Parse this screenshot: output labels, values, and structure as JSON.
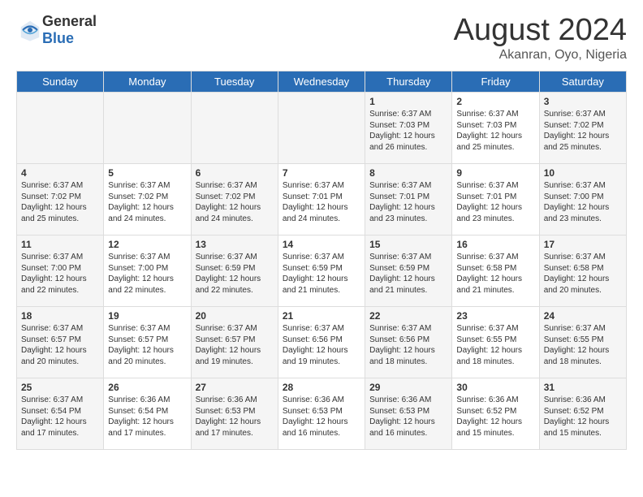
{
  "header": {
    "logo_general": "General",
    "logo_blue": "Blue",
    "month_title": "August 2024",
    "subtitle": "Akanran, Oyo, Nigeria"
  },
  "days_of_week": [
    "Sunday",
    "Monday",
    "Tuesday",
    "Wednesday",
    "Thursday",
    "Friday",
    "Saturday"
  ],
  "weeks": [
    [
      {
        "day": "",
        "content": ""
      },
      {
        "day": "",
        "content": ""
      },
      {
        "day": "",
        "content": ""
      },
      {
        "day": "",
        "content": ""
      },
      {
        "day": "1",
        "content": "Sunrise: 6:37 AM\nSunset: 7:03 PM\nDaylight: 12 hours\nand 26 minutes."
      },
      {
        "day": "2",
        "content": "Sunrise: 6:37 AM\nSunset: 7:03 PM\nDaylight: 12 hours\nand 25 minutes."
      },
      {
        "day": "3",
        "content": "Sunrise: 6:37 AM\nSunset: 7:02 PM\nDaylight: 12 hours\nand 25 minutes."
      }
    ],
    [
      {
        "day": "4",
        "content": "Sunrise: 6:37 AM\nSunset: 7:02 PM\nDaylight: 12 hours\nand 25 minutes."
      },
      {
        "day": "5",
        "content": "Sunrise: 6:37 AM\nSunset: 7:02 PM\nDaylight: 12 hours\nand 24 minutes."
      },
      {
        "day": "6",
        "content": "Sunrise: 6:37 AM\nSunset: 7:02 PM\nDaylight: 12 hours\nand 24 minutes."
      },
      {
        "day": "7",
        "content": "Sunrise: 6:37 AM\nSunset: 7:01 PM\nDaylight: 12 hours\nand 24 minutes."
      },
      {
        "day": "8",
        "content": "Sunrise: 6:37 AM\nSunset: 7:01 PM\nDaylight: 12 hours\nand 23 minutes."
      },
      {
        "day": "9",
        "content": "Sunrise: 6:37 AM\nSunset: 7:01 PM\nDaylight: 12 hours\nand 23 minutes."
      },
      {
        "day": "10",
        "content": "Sunrise: 6:37 AM\nSunset: 7:00 PM\nDaylight: 12 hours\nand 23 minutes."
      }
    ],
    [
      {
        "day": "11",
        "content": "Sunrise: 6:37 AM\nSunset: 7:00 PM\nDaylight: 12 hours\nand 22 minutes."
      },
      {
        "day": "12",
        "content": "Sunrise: 6:37 AM\nSunset: 7:00 PM\nDaylight: 12 hours\nand 22 minutes."
      },
      {
        "day": "13",
        "content": "Sunrise: 6:37 AM\nSunset: 6:59 PM\nDaylight: 12 hours\nand 22 minutes."
      },
      {
        "day": "14",
        "content": "Sunrise: 6:37 AM\nSunset: 6:59 PM\nDaylight: 12 hours\nand 21 minutes."
      },
      {
        "day": "15",
        "content": "Sunrise: 6:37 AM\nSunset: 6:59 PM\nDaylight: 12 hours\nand 21 minutes."
      },
      {
        "day": "16",
        "content": "Sunrise: 6:37 AM\nSunset: 6:58 PM\nDaylight: 12 hours\nand 21 minutes."
      },
      {
        "day": "17",
        "content": "Sunrise: 6:37 AM\nSunset: 6:58 PM\nDaylight: 12 hours\nand 20 minutes."
      }
    ],
    [
      {
        "day": "18",
        "content": "Sunrise: 6:37 AM\nSunset: 6:57 PM\nDaylight: 12 hours\nand 20 minutes."
      },
      {
        "day": "19",
        "content": "Sunrise: 6:37 AM\nSunset: 6:57 PM\nDaylight: 12 hours\nand 20 minutes."
      },
      {
        "day": "20",
        "content": "Sunrise: 6:37 AM\nSunset: 6:57 PM\nDaylight: 12 hours\nand 19 minutes."
      },
      {
        "day": "21",
        "content": "Sunrise: 6:37 AM\nSunset: 6:56 PM\nDaylight: 12 hours\nand 19 minutes."
      },
      {
        "day": "22",
        "content": "Sunrise: 6:37 AM\nSunset: 6:56 PM\nDaylight: 12 hours\nand 18 minutes."
      },
      {
        "day": "23",
        "content": "Sunrise: 6:37 AM\nSunset: 6:55 PM\nDaylight: 12 hours\nand 18 minutes."
      },
      {
        "day": "24",
        "content": "Sunrise: 6:37 AM\nSunset: 6:55 PM\nDaylight: 12 hours\nand 18 minutes."
      }
    ],
    [
      {
        "day": "25",
        "content": "Sunrise: 6:37 AM\nSunset: 6:54 PM\nDaylight: 12 hours\nand 17 minutes."
      },
      {
        "day": "26",
        "content": "Sunrise: 6:36 AM\nSunset: 6:54 PM\nDaylight: 12 hours\nand 17 minutes."
      },
      {
        "day": "27",
        "content": "Sunrise: 6:36 AM\nSunset: 6:53 PM\nDaylight: 12 hours\nand 17 minutes."
      },
      {
        "day": "28",
        "content": "Sunrise: 6:36 AM\nSunset: 6:53 PM\nDaylight: 12 hours\nand 16 minutes."
      },
      {
        "day": "29",
        "content": "Sunrise: 6:36 AM\nSunset: 6:53 PM\nDaylight: 12 hours\nand 16 minutes."
      },
      {
        "day": "30",
        "content": "Sunrise: 6:36 AM\nSunset: 6:52 PM\nDaylight: 12 hours\nand 15 minutes."
      },
      {
        "day": "31",
        "content": "Sunrise: 6:36 AM\nSunset: 6:52 PM\nDaylight: 12 hours\nand 15 minutes."
      }
    ]
  ]
}
